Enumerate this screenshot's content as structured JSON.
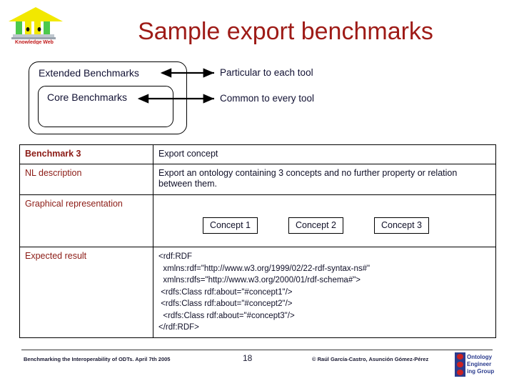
{
  "slide": {
    "title": "Sample export benchmarks",
    "page_number": "18",
    "title_color": "#9E1B17",
    "label_color": "#8B1A14"
  },
  "logo": {
    "name": "knowledge-web-logo",
    "caption": "Knowledge Web"
  },
  "diagram": {
    "outer_label": "Extended  Benchmarks",
    "inner_label": "Core Benchmarks",
    "outer_note": "Particular to each tool",
    "inner_note": "Common to every tool"
  },
  "table": {
    "rows": [
      {
        "label": "Benchmark 3",
        "bold": true,
        "value": "Export concept"
      },
      {
        "label": "NL description",
        "bold": false,
        "value": "Export an ontology containing 3 concepts and no further property or relation between them."
      },
      {
        "label": "Graphical representation",
        "bold": false,
        "concepts": [
          "Concept 1",
          "Concept 2",
          "Concept 3"
        ]
      },
      {
        "label": "Expected result",
        "bold": false,
        "code": "<rdf:RDF\n  xmlns:rdf=\"http://www.w3.org/1999/02/22-rdf-syntax-ns#\"\n  xmlns:rdfs=\"http://www.w3.org/2000/01/rdf-schema#\">\n <rdfs:Class rdf:about=\"#concept1\"/>\n <rdfs:Class rdf:about=\"#concept2\"/>\n  <rdfs:Class rdf:about=\"#concept3\"/>\n</rdf:RDF>"
      }
    ]
  },
  "footer": {
    "left": "Benchmarking the Interoperability of ODTs. April 7th 2005",
    "page": "18",
    "right": "© Raúl García-Castro, Asunción Gómez-Pérez",
    "oeg": {
      "line1": "Ontology",
      "line2": "Engineer",
      "line3": "ing Group"
    }
  }
}
